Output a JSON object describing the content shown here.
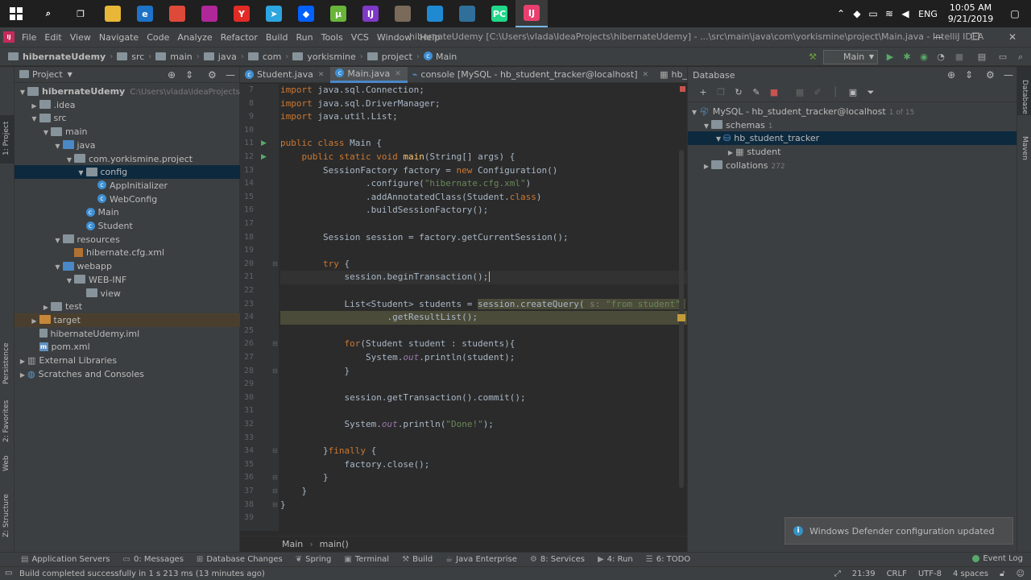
{
  "taskbar": {
    "apps": [
      {
        "name": "search",
        "glyph": "⌕",
        "color": "#1f1f1f"
      },
      {
        "name": "task-view",
        "glyph": "❐",
        "color": "#1f1f1f"
      },
      {
        "name": "file-explorer",
        "glyph": "",
        "color": "#e8b738"
      },
      {
        "name": "edge",
        "glyph": "e",
        "color": "#1e73c6"
      },
      {
        "name": "chrome",
        "glyph": "",
        "color": "#de4a3a"
      },
      {
        "name": "jetbrains-toolbox",
        "glyph": "",
        "color": "#b0279a"
      },
      {
        "name": "yandex",
        "glyph": "Y",
        "color": "#e22b25"
      },
      {
        "name": "telegram",
        "glyph": "➤",
        "color": "#2ca5e0"
      },
      {
        "name": "dropbox",
        "glyph": "◆",
        "color": "#0061ff"
      },
      {
        "name": "utorrent",
        "glyph": "µ",
        "color": "#69b53a"
      },
      {
        "name": "intellij-community",
        "glyph": "IJ",
        "color": "#7e39c7"
      },
      {
        "name": "winrar",
        "glyph": "",
        "color": "#7a6a5a"
      },
      {
        "name": "vscode",
        "glyph": "",
        "color": "#1f8ad2"
      },
      {
        "name": "mysql-workbench",
        "glyph": "",
        "color": "#2f6f9a"
      },
      {
        "name": "pycharm",
        "glyph": "PC",
        "color": "#21d789"
      },
      {
        "name": "intellij-ultimate",
        "glyph": "IJ",
        "color": "#e83f6f"
      }
    ],
    "lang": "ENG",
    "time": "10:05 AM",
    "date": "9/21/2019"
  },
  "menubar": {
    "items": [
      "File",
      "Edit",
      "View",
      "Navigate",
      "Code",
      "Analyze",
      "Refactor",
      "Build",
      "Run",
      "Tools",
      "VCS",
      "Window",
      "Help"
    ],
    "title": "hibernateUdemy [C:\\Users\\vlada\\IdeaProjects\\hibernateUdemy] - ...\\src\\main\\java\\com\\yorkismine\\project\\Main.java - IntelliJ IDEA"
  },
  "navbar": {
    "crumbs": [
      "hibernateUdemy",
      "src",
      "main",
      "java",
      "com",
      "yorkismine",
      "project",
      "Main"
    ],
    "run_config": "Main"
  },
  "left_strip": {
    "tabs": [
      "1: Project",
      "Persistence",
      "2: Favorites",
      "Web",
      "Z: Structure"
    ]
  },
  "right_strip": {
    "tabs": [
      "Database",
      "Maven"
    ]
  },
  "project": {
    "header": "Project",
    "tree": [
      {
        "label": "hibernateUdemy",
        "hint": "C:\\Users\\vlada\\IdeaProjects\\hibernate",
        "indent": 0,
        "arrow": "▼",
        "icon": "folder-gray",
        "bold": true
      },
      {
        "label": ".idea",
        "indent": 1,
        "arrow": "▶",
        "icon": "folder-gray"
      },
      {
        "label": "src",
        "indent": 1,
        "arrow": "▼",
        "icon": "folder-gray"
      },
      {
        "label": "main",
        "indent": 2,
        "arrow": "▼",
        "icon": "folder-gray"
      },
      {
        "label": "java",
        "indent": 3,
        "arrow": "▼",
        "icon": "folder-blue"
      },
      {
        "label": "com.yorkismine.project",
        "indent": 4,
        "arrow": "▼",
        "icon": "folder-gray"
      },
      {
        "label": "config",
        "indent": 5,
        "arrow": "▼",
        "icon": "folder-gray",
        "selected": true
      },
      {
        "label": "AppInitializer",
        "indent": 6,
        "arrow": "",
        "icon": "class"
      },
      {
        "label": "WebConfig",
        "indent": 6,
        "arrow": "",
        "icon": "class"
      },
      {
        "label": "Main",
        "indent": 5,
        "arrow": "",
        "icon": "class"
      },
      {
        "label": "Student",
        "indent": 5,
        "arrow": "",
        "icon": "class"
      },
      {
        "label": "resources",
        "indent": 3,
        "arrow": "▼",
        "icon": "folder-gray"
      },
      {
        "label": "hibernate.cfg.xml",
        "indent": 4,
        "arrow": "",
        "icon": "xml"
      },
      {
        "label": "webapp",
        "indent": 3,
        "arrow": "▼",
        "icon": "folder-blue"
      },
      {
        "label": "WEB-INF",
        "indent": 4,
        "arrow": "▼",
        "icon": "folder-gray"
      },
      {
        "label": "view",
        "indent": 5,
        "arrow": "",
        "icon": "folder-gray"
      },
      {
        "label": "test",
        "indent": 2,
        "arrow": "▶",
        "icon": "folder-gray"
      },
      {
        "label": "target",
        "indent": 1,
        "arrow": "▶",
        "icon": "folder-orange",
        "target": true
      },
      {
        "label": "hibernateUdemy.iml",
        "indent": 1,
        "arrow": "",
        "icon": "iml"
      },
      {
        "label": "pom.xml",
        "indent": 1,
        "arrow": "",
        "icon": "maven"
      },
      {
        "label": "External Libraries",
        "indent": 0,
        "arrow": "▶",
        "icon": "libs"
      },
      {
        "label": "Scratches and Consoles",
        "indent": 0,
        "arrow": "▶",
        "icon": "scratch"
      }
    ]
  },
  "editor": {
    "tabs": [
      {
        "label": "Student.java",
        "icon": "class",
        "active": false
      },
      {
        "label": "Main.java",
        "icon": "class",
        "active": true
      },
      {
        "label": "console [MySQL - hb_student_tracker@localhost]",
        "icon": "console",
        "active": false
      },
      {
        "label": "hb_student_tra",
        "icon": "table",
        "active": false
      }
    ],
    "first_line": 7,
    "lines": [
      [
        [
          "kw",
          "import "
        ],
        [
          "",
          "java.sql.Connection;"
        ]
      ],
      [
        [
          "kw",
          "import "
        ],
        [
          "",
          "java.sql.DriverManager;"
        ]
      ],
      [
        [
          "kw",
          "import "
        ],
        [
          "",
          "java.util.List;"
        ]
      ],
      [],
      [
        [
          "kw",
          "public class "
        ],
        [
          "",
          "Main {"
        ]
      ],
      [
        [
          "",
          "    "
        ],
        [
          "kw",
          "public static void "
        ],
        [
          "fn",
          "main"
        ],
        [
          "",
          "(String[] args) {"
        ]
      ],
      [
        [
          "",
          "        SessionFactory factory = "
        ],
        [
          "kw",
          "new "
        ],
        [
          "",
          "Configuration()"
        ]
      ],
      [
        [
          "",
          "                .configure("
        ],
        [
          "str",
          "\"hibernate.cfg.xml\""
        ],
        [
          "",
          ")"
        ]
      ],
      [
        [
          "",
          "                .addAnnotatedClass(Student."
        ],
        [
          "kw",
          "class"
        ],
        [
          "",
          ")"
        ]
      ],
      [
        [
          "",
          "                .buildSessionFactory();"
        ]
      ],
      [],
      [
        [
          "",
          "        Session session = factory.getCurrentSession();"
        ]
      ],
      [],
      [
        [
          "",
          "        "
        ],
        [
          "kw",
          "try "
        ],
        [
          "",
          "{"
        ]
      ],
      [
        [
          "",
          "            session.beginTransaction();"
        ]
      ],
      [],
      [
        [
          "",
          "            List<Student> students = "
        ],
        [
          "hl",
          "session.createQuery( "
        ],
        [
          "hldim",
          "s: "
        ],
        [
          "hlstr",
          "\"from student\""
        ],
        [
          "hl",
          ")"
        ]
      ],
      [
        [
          "hl",
          "                    .getResultList();"
        ]
      ],
      [],
      [
        [
          "",
          "            "
        ],
        [
          "kw",
          "for"
        ],
        [
          "",
          "(Student student : students){"
        ]
      ],
      [
        [
          "",
          "                System."
        ],
        [
          "it",
          "out"
        ],
        [
          "",
          ".println(student);"
        ]
      ],
      [
        [
          "",
          "            }"
        ]
      ],
      [],
      [
        [
          "",
          "            session.getTransaction().commit();"
        ]
      ],
      [],
      [
        [
          "",
          "            System."
        ],
        [
          "it",
          "out"
        ],
        [
          "",
          ".println("
        ],
        [
          "str",
          "\"Done!\""
        ],
        [
          "",
          ");"
        ]
      ],
      [],
      [
        [
          "",
          "        }"
        ],
        [
          "kw",
          "finally "
        ],
        [
          "",
          "{"
        ]
      ],
      [
        [
          "",
          "            factory.close();"
        ]
      ],
      [
        [
          "",
          "        }"
        ]
      ],
      [
        [
          "",
          "    }"
        ]
      ],
      [
        [
          "",
          "}"
        ]
      ],
      []
    ],
    "breadcrumb": [
      "Main",
      "main()"
    ]
  },
  "database": {
    "header": "Database",
    "tree": [
      {
        "label": "MySQL - hb_student_tracker@localhost",
        "count": "1 of 15",
        "indent": 0,
        "arrow": "▼",
        "icon": "db"
      },
      {
        "label": "schemas",
        "count": "1",
        "indent": 1,
        "arrow": "▼",
        "icon": "folder-gray"
      },
      {
        "label": "hb_student_tracker",
        "count": "",
        "indent": 2,
        "arrow": "▼",
        "icon": "schema",
        "selected": true
      },
      {
        "label": "student",
        "count": "",
        "indent": 3,
        "arrow": "▶",
        "icon": "table"
      },
      {
        "label": "collations",
        "count": "272",
        "indent": 1,
        "arrow": "▶",
        "icon": "folder-gray"
      }
    ]
  },
  "notification": {
    "text": "Windows Defender configuration updated"
  },
  "tool_windows": {
    "items": [
      "Application Servers",
      "0: Messages",
      "Database Changes",
      "Spring",
      "Terminal",
      "Build",
      "Java Enterprise",
      "8: Services",
      "4: Run",
      "6: TODO"
    ],
    "event_log": "Event Log"
  },
  "status": {
    "message": "Build completed successfully in 1 s 213 ms (13 minutes ago)",
    "position": "21:39",
    "line_sep": "CRLF",
    "encoding": "UTF-8",
    "indent": "4 spaces"
  },
  "colors": {
    "accent": "#4a88c7",
    "selection": "#0d293e",
    "keyword": "#cc7832",
    "string": "#6a8759"
  }
}
